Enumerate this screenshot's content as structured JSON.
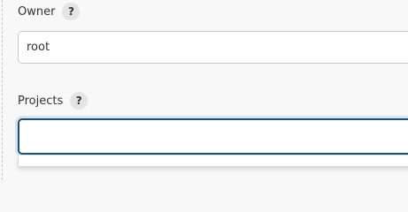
{
  "owner": {
    "label": "Owner",
    "help": "?",
    "value": "root"
  },
  "projects": {
    "label": "Projects",
    "help": "?",
    "value": ""
  }
}
